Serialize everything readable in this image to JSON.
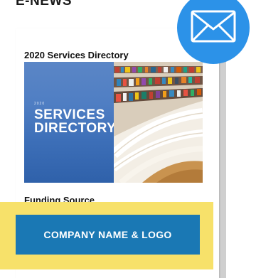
{
  "header": {
    "title": "E-NEWS"
  },
  "newsletter": {
    "directory_heading": "2020 Services Directory",
    "cover": {
      "year": "2020",
      "line1": "SERVICES",
      "line2": "DIRECTORY"
    },
    "funding_label": "Funding Source"
  },
  "cta": {
    "label": "COMPANY NAME & LOGO"
  },
  "icons": {
    "mail": "envelope-icon",
    "photo": "library-bookshelves-photo"
  },
  "colors": {
    "accent_blue": "#2c92e8",
    "button_blue": "#1a78b4",
    "highlight_yellow": "#f7e16a",
    "cover_blue": "#3d6fb8"
  }
}
